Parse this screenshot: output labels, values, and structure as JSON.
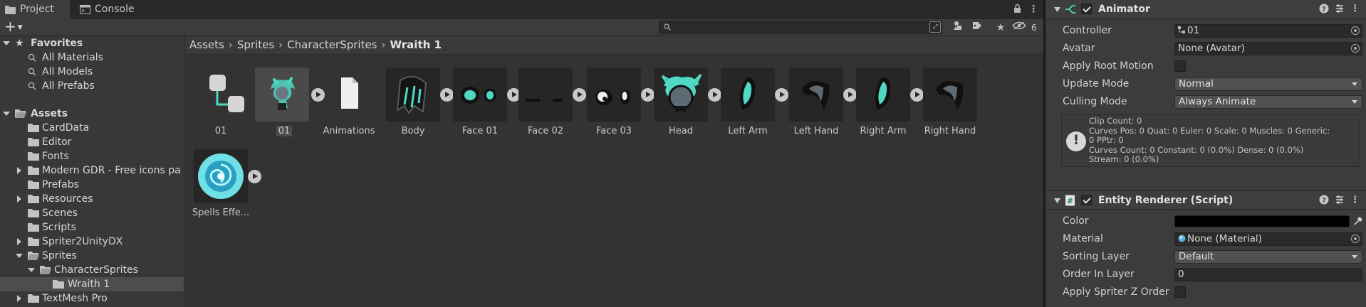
{
  "tabs": [
    {
      "label": "Project",
      "active": true
    },
    {
      "label": "Console",
      "active": false
    }
  ],
  "toolbar": {
    "add_label": "+",
    "search_placeholder": "",
    "hidden_packages_count": "6"
  },
  "tree": {
    "favorites": {
      "label": "Favorites",
      "items": [
        "All Materials",
        "All Models",
        "All Prefabs"
      ]
    },
    "assets_label": "Assets",
    "folders": [
      "CardData",
      "Editor",
      "Fonts",
      "Modern GDR - Free icons pa",
      "Prefabs",
      "Resources",
      "Scenes",
      "Scripts",
      "Spriter2UnityDX",
      "Sprites",
      "CharacterSprites",
      "Wraith 1",
      "TextMesh Pro"
    ]
  },
  "breadcrumb": [
    "Assets",
    "Sprites",
    "CharacterSprites",
    "Wraith 1"
  ],
  "grid_items": [
    {
      "name": "01",
      "kind": "animator-controller"
    },
    {
      "name": "01",
      "kind": "prefab",
      "selected": true
    },
    {
      "name": "Animations",
      "kind": "folder"
    },
    {
      "name": "Body",
      "kind": "sprite"
    },
    {
      "name": "Face 01",
      "kind": "sprite"
    },
    {
      "name": "Face 02",
      "kind": "sprite"
    },
    {
      "name": "Face 03",
      "kind": "sprite"
    },
    {
      "name": "Head",
      "kind": "sprite"
    },
    {
      "name": "Left Arm",
      "kind": "sprite"
    },
    {
      "name": "Left Hand",
      "kind": "sprite"
    },
    {
      "name": "Right Arm",
      "kind": "sprite"
    },
    {
      "name": "Right Hand",
      "kind": "sprite"
    },
    {
      "name": "Spells Effe...",
      "kind": "sprite"
    }
  ],
  "inspector": {
    "animator": {
      "title": "Animator",
      "enabled": true,
      "props": {
        "controller": {
          "label": "Controller",
          "value": "01"
        },
        "avatar": {
          "label": "Avatar",
          "value": "None (Avatar)"
        },
        "apply_root_motion": {
          "label": "Apply Root Motion"
        },
        "update_mode": {
          "label": "Update Mode",
          "value": "Normal"
        },
        "culling_mode": {
          "label": "Culling Mode",
          "value": "Always Animate"
        }
      },
      "info_lines": [
        "Clip Count: 0",
        "Curves Pos: 0 Quat: 0 Euler: 0 Scale: 0 Muscles: 0 Generic:",
        "0 PPtr: 0",
        "Curves Count: 0 Constant: 0 (0.0%) Dense: 0 (0.0%)",
        "Stream: 0 (0.0%)"
      ]
    },
    "entity_renderer": {
      "title": "Entity Renderer (Script)",
      "enabled": true,
      "props": {
        "color": {
          "label": "Color",
          "value": "#000000"
        },
        "material": {
          "label": "Material",
          "value": "None (Material)"
        },
        "sorting_layer": {
          "label": "Sorting Layer",
          "value": "Default"
        },
        "order_in_layer": {
          "label": "Order In Layer",
          "value": "0"
        },
        "apply_spriter_z_order": {
          "label": "Apply Spriter Z Order"
        }
      }
    }
  },
  "colors": {
    "accent_teal": "#4fd8c4",
    "panel_bg": "#383838",
    "grid_bg": "#333333",
    "inspector_bg": "#3c3c3c"
  }
}
